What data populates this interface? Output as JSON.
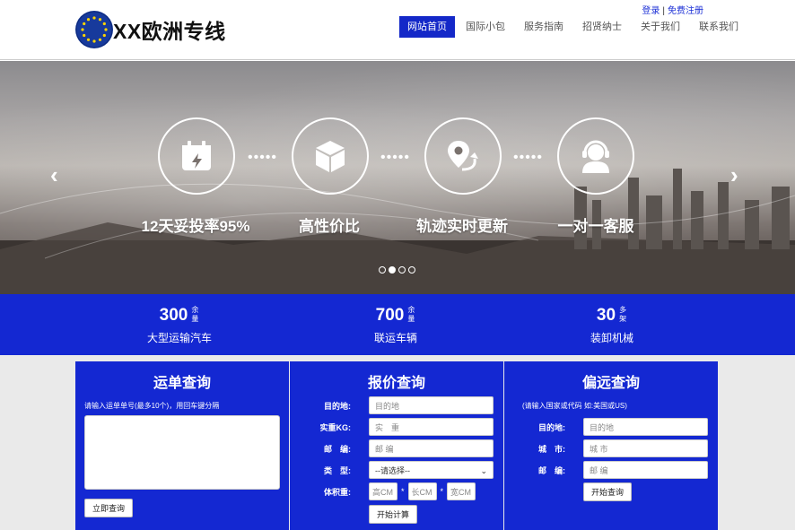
{
  "header": {
    "logo_text": "XX欧洲专线",
    "login": "登录",
    "separator": "|",
    "register": "免费注册"
  },
  "nav": [
    {
      "label": "网站首页",
      "active": true
    },
    {
      "label": "国际小包",
      "active": false
    },
    {
      "label": "服务指南",
      "active": false
    },
    {
      "label": "招贤纳士",
      "active": false
    },
    {
      "label": "关于我们",
      "active": false
    },
    {
      "label": "联系我们",
      "active": false
    }
  ],
  "banner": {
    "features": [
      {
        "icon": "calendar-bolt-icon",
        "label": "12天妥投率95%"
      },
      {
        "icon": "box-icon",
        "label": "高性价比"
      },
      {
        "icon": "location-route-icon",
        "label": "轨迹实时更新"
      },
      {
        "icon": "customer-service-icon",
        "label": "一对一客服"
      }
    ],
    "dots": "•••••",
    "prev": "‹",
    "next": "›",
    "active_slide": 2,
    "slide_count": 4
  },
  "stats": [
    {
      "number": "300",
      "unit": "余量",
      "label": "大型运输汽车"
    },
    {
      "number": "700",
      "unit": "余量",
      "label": "联运车辆"
    },
    {
      "number": "30",
      "unit": "多架",
      "label": "装卸机械"
    }
  ],
  "waybill": {
    "title": "运单查询",
    "hint": "请输入运单单号(最多10个)，用回车键分隔",
    "button": "立即查询"
  },
  "quote": {
    "title": "报价查询",
    "destination_label": "目的地:",
    "destination_placeholder": "目的地",
    "weight_label": "实重KG:",
    "weight_placeholder": "实　重",
    "postcode_label": "邮　编:",
    "postcode_placeholder": "邮 编",
    "type_label": "类　型:",
    "type_value": "--请选择--",
    "volume_label": "体积重:",
    "height_placeholder": "高CM",
    "length_placeholder": "长CM",
    "width_placeholder": "宽CM",
    "star": "*",
    "button": "开始计算"
  },
  "remote": {
    "title": "偏远查询",
    "hint": "(请输入国家或代码 如:美国或US)",
    "destination_label": "目的地:",
    "destination_placeholder": "目的地",
    "city_label": "城　市:",
    "city_placeholder": "城 市",
    "postcode_label": "邮　编:",
    "postcode_placeholder": "邮 编",
    "button": "开始查询"
  },
  "colors": {
    "brand_blue": "#1428d2",
    "nav_active": "#1428c8"
  }
}
